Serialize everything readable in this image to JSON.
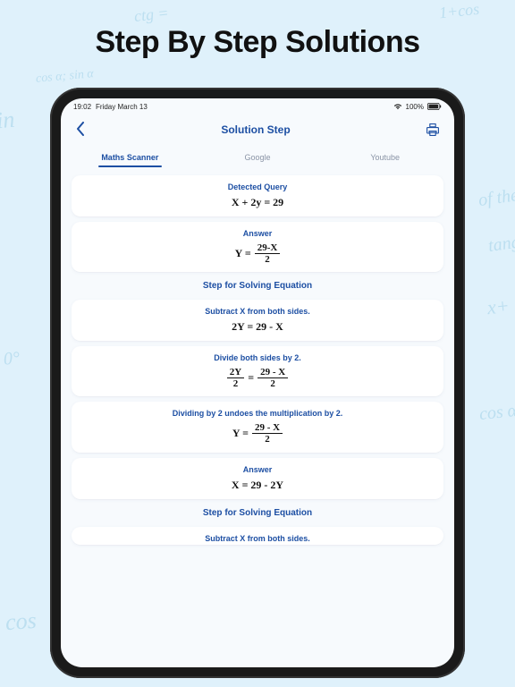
{
  "promo": {
    "headline": "Step By Step Solutions"
  },
  "statusbar": {
    "time": "19:02",
    "date": "Friday March 13",
    "battery_pct": "100%"
  },
  "nav": {
    "title": "Solution Step"
  },
  "tabs": {
    "maths": "Maths Scanner",
    "google": "Google",
    "youtube": "Youtube"
  },
  "sections": {
    "detected_query": "Detected Query",
    "answer": "Answer",
    "steps_title": "Step for Solving Equation"
  },
  "hints": {
    "subtract_x": "Subtract X from both sides.",
    "divide_2": "Divide both sides by 2.",
    "undo_mult": "Dividing by 2 undoes the multiplication by 2."
  },
  "math": {
    "query": "X + 2y = 29",
    "answer_lhs": "Y =",
    "answer_num": "29-X",
    "answer_den": "2",
    "step1": "2Y = 29 - X",
    "step2_lnum": "2Y",
    "step2_lden": "2",
    "step2_eq": "=",
    "step2_rnum": "29 - X",
    "step2_rden": "2",
    "step3_lhs": "Y =",
    "step3_num": "29 - X",
    "step3_den": "2",
    "final": "X = 29 - 2Y"
  },
  "doodles": {
    "d1": "ctg =",
    "d2": "1+cos",
    "d3": "sin",
    "d4": "cos α; sin α",
    "d5": "of the",
    "d6": "tangent",
    "d7": "x+",
    "d8": "cos α",
    "d9": "0°",
    "d10": "cos"
  }
}
